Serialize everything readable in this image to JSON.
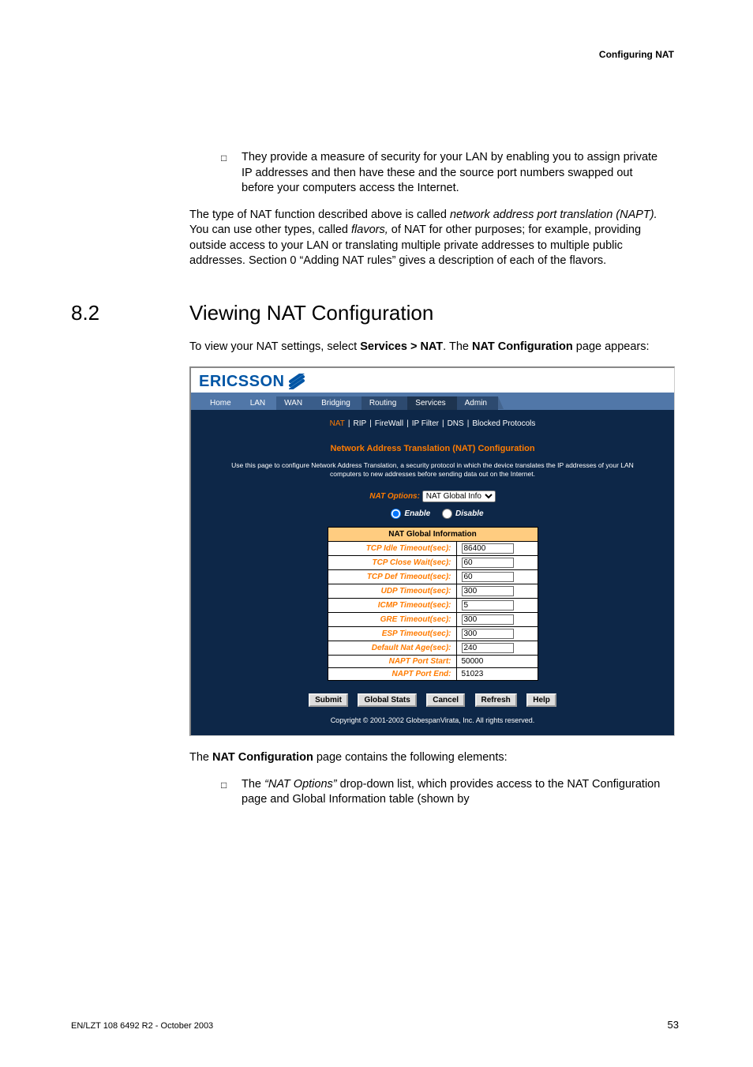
{
  "doc_header": "Configuring NAT",
  "bullet1": "They provide a measure of security for your LAN by enabling you to assign private IP addresses and then have these and the source port numbers swapped out before your computers access the Internet.",
  "para1_a": "The type of NAT function described above is called ",
  "para1_i1": "network address port translation (NAPT).",
  "para1_b": " You can use other types, called ",
  "para1_i2": "flavors,",
  "para1_c": " of NAT for other purposes; for example, providing outside access to your LAN or translating multiple private addresses to multiple public addresses. Section 0 “Adding NAT rules” gives a description of each of the flavors.",
  "section_num": "8.2",
  "section_title": "Viewing NAT Configuration",
  "intro_a": "To view your NAT settings, select ",
  "intro_b1": "Services > NAT",
  "intro_c": ". The ",
  "intro_b2": "NAT Configuration",
  "intro_d": " page appears:",
  "brand": "ERICSSON",
  "tabs": {
    "home": "Home",
    "lan": "LAN",
    "wan": "WAN",
    "bridging": "Bridging",
    "routing": "Routing",
    "services": "Services",
    "admin": "Admin"
  },
  "subnav": {
    "nat": "NAT",
    "rip": "RIP",
    "firewall": "FireWall",
    "ipfilter": "IP Filter",
    "dns": "DNS",
    "blocked": "Blocked Protocols"
  },
  "panel_title": "Network Address Translation (NAT) Configuration",
  "panel_desc_a": "Use this page to configure Network Address Translation, a security protocol in which the device translates the IP addresses of your LAN",
  "panel_desc_b": "computers to new addresses before sending data out on the Internet.",
  "nat_options_label": "NAT Options:",
  "nat_options_value": "NAT Global Info",
  "enable_label": "Enable",
  "disable_label": "Disable",
  "table_header": "NAT Global Information",
  "rows": {
    "tcp_idle": {
      "label": "TCP Idle Timeout(sec):",
      "val": "86400",
      "editable": true
    },
    "tcp_close": {
      "label": "TCP Close Wait(sec):",
      "val": "60",
      "editable": true
    },
    "tcp_def": {
      "label": "TCP Def Timeout(sec):",
      "val": "60",
      "editable": true
    },
    "udp": {
      "label": "UDP Timeout(sec):",
      "val": "300",
      "editable": true
    },
    "icmp": {
      "label": "ICMP Timeout(sec):",
      "val": "5",
      "editable": true
    },
    "gre": {
      "label": "GRE Timeout(sec):",
      "val": "300",
      "editable": true
    },
    "esp": {
      "label": "ESP Timeout(sec):",
      "val": "300",
      "editable": true
    },
    "defage": {
      "label": "Default Nat Age(sec):",
      "val": "240",
      "editable": true
    },
    "pstart": {
      "label": "NAPT Port Start:",
      "val": "50000",
      "editable": false
    },
    "pend": {
      "label": "NAPT Port End:",
      "val": "51023",
      "editable": false
    }
  },
  "buttons": {
    "submit": "Submit",
    "gstats": "Global Stats",
    "cancel": "Cancel",
    "refresh": "Refresh",
    "help": "Help"
  },
  "copyright": "Copyright © 2001-2002 GlobespanVirata, Inc. All rights reserved.",
  "after_a": "The ",
  "after_b": "NAT Configuration",
  "after_c": " page contains the following elements:",
  "bullet2_a": "The ",
  "bullet2_i": "“NAT Options”",
  "bullet2_b": " drop-down list, which provides access to the NAT Configuration page and Global Information table (shown by",
  "footer_left": "EN/LZT 108 6492 R2 - October 2003",
  "footer_right": "53"
}
